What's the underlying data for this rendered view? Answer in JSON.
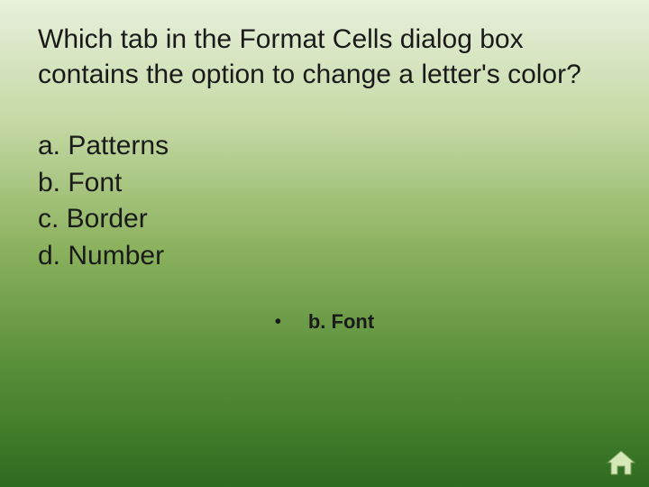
{
  "question": "Which tab in the Format Cells dialog box contains the option to change a letter's color?",
  "options": {
    "a": "a. Patterns",
    "b": "b. Font",
    "c": "c. Border",
    "d": "d. Number"
  },
  "bullet": "•",
  "answer": "b. Font"
}
